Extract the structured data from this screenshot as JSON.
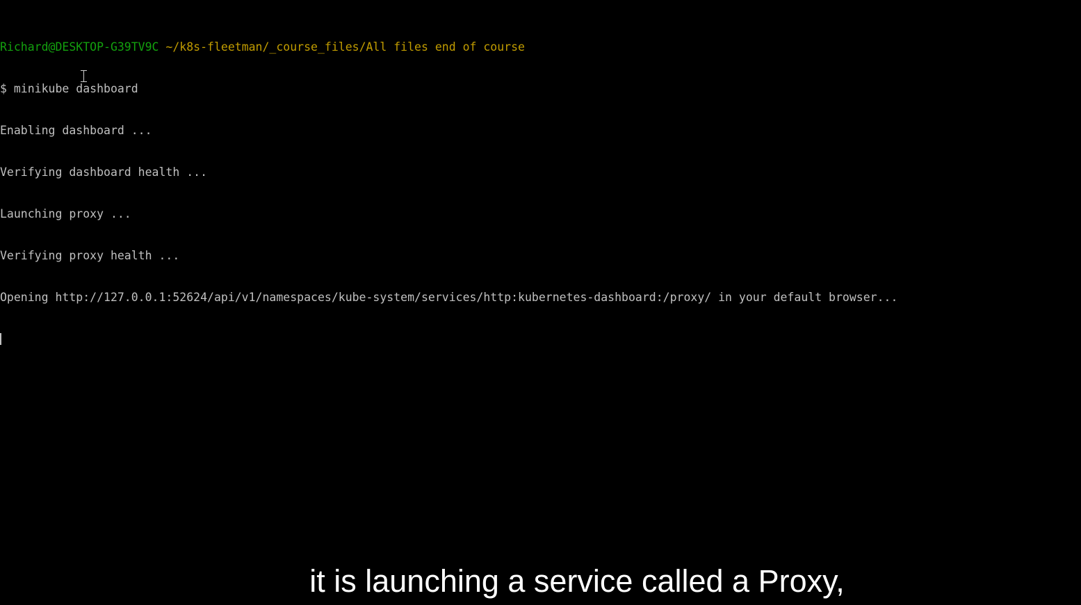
{
  "terminal": {
    "prompt_user": "Richard@DESKTOP-G39TV9C",
    "prompt_path": "~/k8s-fleetman/_course_files/All files end of course",
    "lines": [
      "$ minikube dashboard",
      "Enabling dashboard ...",
      "Verifying dashboard health ...",
      "Launching proxy ...",
      "Verifying proxy health ...",
      "Opening http://127.0.0.1:52624/api/v1/namespaces/kube-system/services/http:kubernetes-dashboard:/proxy/ in your default browser..."
    ]
  },
  "subtitle": {
    "text": "it is launching a service called a Proxy,"
  },
  "colors": {
    "background": "#000000",
    "text": "#c0c0c0",
    "prompt_user": "#13a10e",
    "prompt_path": "#c19c00",
    "subtitle": "#ffffff"
  }
}
